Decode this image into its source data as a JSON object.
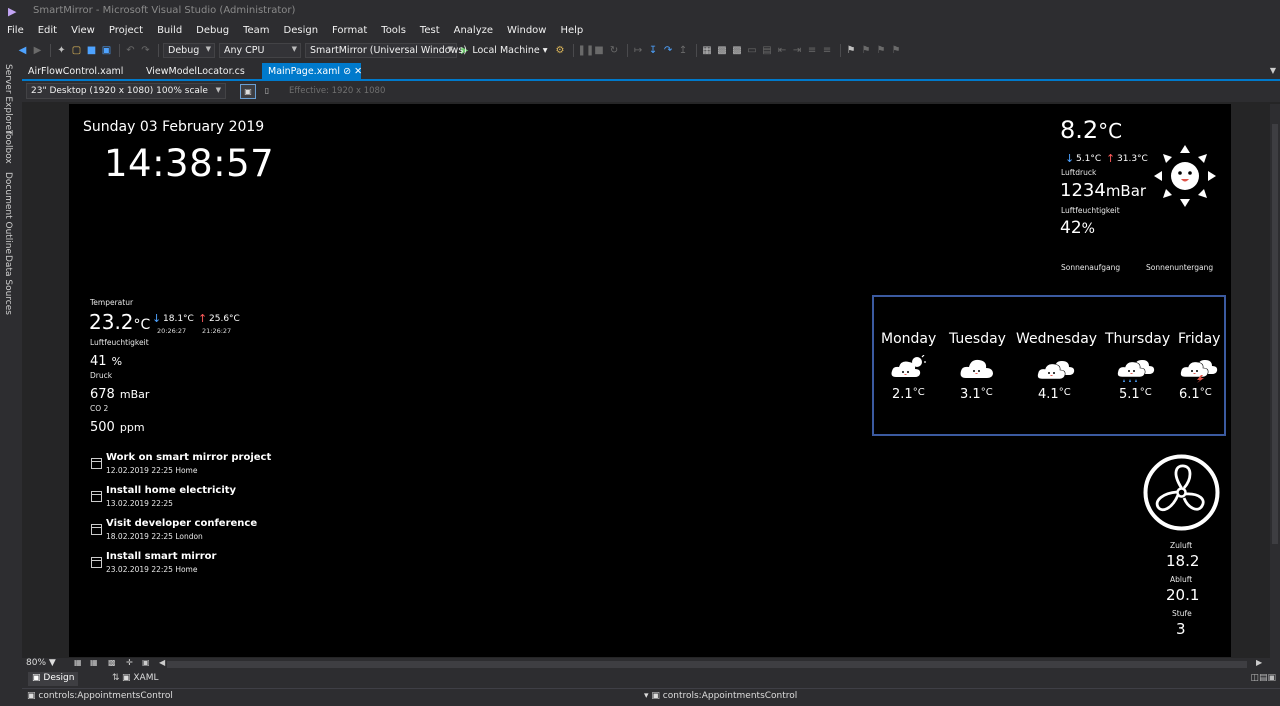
{
  "window": {
    "title": "SmartMirror - Microsoft Visual Studio  (Administrator)"
  },
  "menu": [
    "File",
    "Edit",
    "View",
    "Project",
    "Build",
    "Debug",
    "Team",
    "Design",
    "Format",
    "Tools",
    "Test",
    "Analyze",
    "Window",
    "Help"
  ],
  "toolbar": {
    "configuration": "Debug",
    "platform": "Any CPU",
    "startup_project": "SmartMirror (Universal Windows)",
    "run_target": "Local Machine"
  },
  "left_rail": [
    "Server Explorer",
    "Toolbox",
    "Document Outline",
    "Data Sources"
  ],
  "tabs": [
    {
      "label": "AirFlowControl.xaml",
      "active": false
    },
    {
      "label": "ViewModelLocator.cs",
      "active": false
    },
    {
      "label": "MainPage.xaml",
      "active": true
    }
  ],
  "designer": {
    "device": "23\" Desktop (1920 x 1080) 100% scale",
    "effective": "Effective: 1920 x 1080"
  },
  "mirror": {
    "date": "Sunday 03 February 2019",
    "time": "14:38:57",
    "indoor": {
      "temp_label": "Temperatur",
      "temp_value": "23.2",
      "temp_unit": "°C",
      "min_value": "18.1°C",
      "min_time": "20:26:27",
      "max_value": "25.6°C",
      "max_time": "21:26:27",
      "humidity_label": "Luftfeuchtigkeit",
      "humidity_value": "41",
      "humidity_unit": "%",
      "pressure_label": "Druck",
      "pressure_value": "678",
      "pressure_unit": "mBar",
      "co2_label": "CO 2",
      "co2_value": "500",
      "co2_unit": "ppm"
    },
    "appointments": [
      {
        "title": "Work on smart mirror project",
        "sub": "12.02.2019 22:25 Home"
      },
      {
        "title": "Install home electricity",
        "sub": "13.02.2019 22:25"
      },
      {
        "title": "Visit developer conference",
        "sub": "18.02.2019 22:25 London"
      },
      {
        "title": "Install smart mirror",
        "sub": "23.02.2019 22:25 Home"
      }
    ],
    "outdoor": {
      "temp_value": "8.2",
      "temp_unit": "°C",
      "min_value": "5.1°C",
      "max_value": "31.3°C",
      "pressure_label": "Luftdruck",
      "pressure_value": "1234",
      "pressure_unit": "mBar",
      "humidity_label": "Luftfeuchtigkeit",
      "humidity_value": "42",
      "humidity_unit": "%",
      "sunrise_label": "Sonnenaufgang",
      "sunset_label": "Sonnenuntergang"
    },
    "forecast": [
      {
        "day": "Monday",
        "temp": "2.1",
        "unit": "°C",
        "icon": "sun-cloud-icon"
      },
      {
        "day": "Tuesday",
        "temp": "3.1",
        "unit": "°C",
        "icon": "cloud-icon"
      },
      {
        "day": "Wednesday",
        "temp": "4.1",
        "unit": "°C",
        "icon": "clouds-icon"
      },
      {
        "day": "Thursday",
        "temp": "5.1",
        "unit": "°C",
        "icon": "rain-cloud-icon"
      },
      {
        "day": "Friday",
        "temp": "6.1",
        "unit": "°C",
        "icon": "storm-cloud-icon"
      }
    ],
    "airflow": {
      "supply_label": "Zuluft",
      "supply_value": "18.2",
      "exhaust_label": "Abluft",
      "exhaust_value": "20.1",
      "level_label": "Stufe",
      "level_value": "3"
    }
  },
  "bottom": {
    "zoom": "80%",
    "design_tab": "Design",
    "xaml_tab": "XAML",
    "path_left": "controls:AppointmentsControl",
    "path_right": "controls:AppointmentsControl"
  },
  "colors": {
    "accent": "#007acc",
    "forecast_border": "#3b5aa0",
    "arrow_down": "#4ea3ff",
    "arrow_up": "#ff5a5a"
  }
}
